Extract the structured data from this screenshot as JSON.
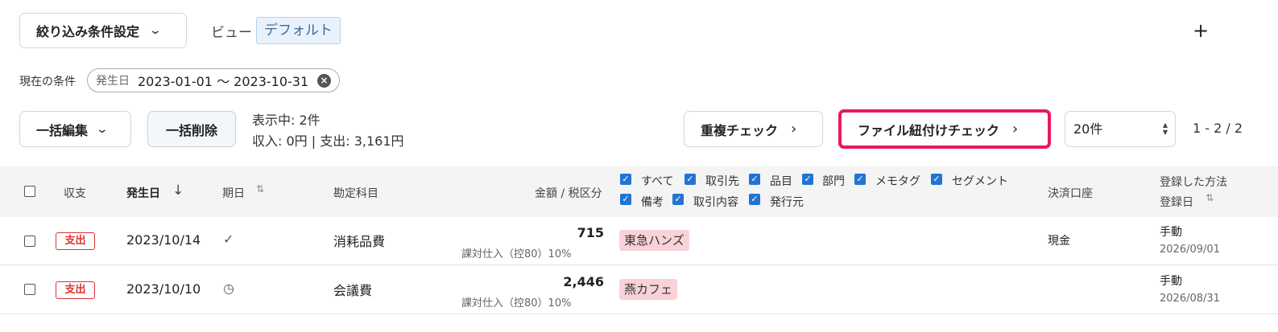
{
  "filter": {
    "button_label": "絞り込み条件設定",
    "chevron": "chevron-down-icon"
  },
  "view": {
    "label": "ビュー",
    "current": "デフォルト"
  },
  "add_icon": "+",
  "condition": {
    "label": "現在の条件",
    "key": "発生日",
    "value": "2023-01-01 〜 2023-10-31",
    "clear_icon": "×"
  },
  "actions": {
    "bulk_edit": "一括編集",
    "bulk_delete": "一括削除",
    "summary_count": "表示中: 2件",
    "summary_amounts": "収入: 0円 | 支出: 3,161円",
    "duplicate_check": "重複チェック",
    "file_link_check": "ファイル紐付けチェック",
    "per_page": "20件",
    "range": "1 - 2 / 2"
  },
  "table": {
    "headers": {
      "type": "収支",
      "date": "発生日",
      "date_sort_icon": "↓",
      "due": "期日",
      "sort_icon": "⇅",
      "account": "勘定科目",
      "amount": "金額 / 税区分",
      "payment_account": "決済口座",
      "reg_method": "登録した方法",
      "reg_date": "登録日"
    },
    "column_toggles": {
      "all": "すべて",
      "partner": "取引先",
      "item": "品目",
      "department": "部門",
      "memo_tag": "メモタグ",
      "segment": "セグメント",
      "note": "備考",
      "description": "取引内容",
      "issuer": "発行元"
    },
    "rows": [
      {
        "type": "支出",
        "date": "2023/10/14",
        "due_icon": "✓",
        "account": "消耗品費",
        "amount": "715",
        "tax": "課対仕入（控80）10%",
        "partner": "東急ハンズ",
        "payment": "現金",
        "method": "手動",
        "reg_date": "2026/09/01"
      },
      {
        "type": "支出",
        "date": "2023/10/10",
        "due_icon": "◷",
        "account": "会議費",
        "amount": "2,446",
        "tax": "課対仕入（控80）10%",
        "partner": "燕カフェ",
        "payment": "",
        "method": "手動",
        "reg_date": "2026/08/31"
      }
    ]
  },
  "colors": {
    "accent": "#2174d4",
    "highlight_border": "#e8195c",
    "expense": "#dd3333",
    "tag_bg": "#f8d2d6"
  }
}
